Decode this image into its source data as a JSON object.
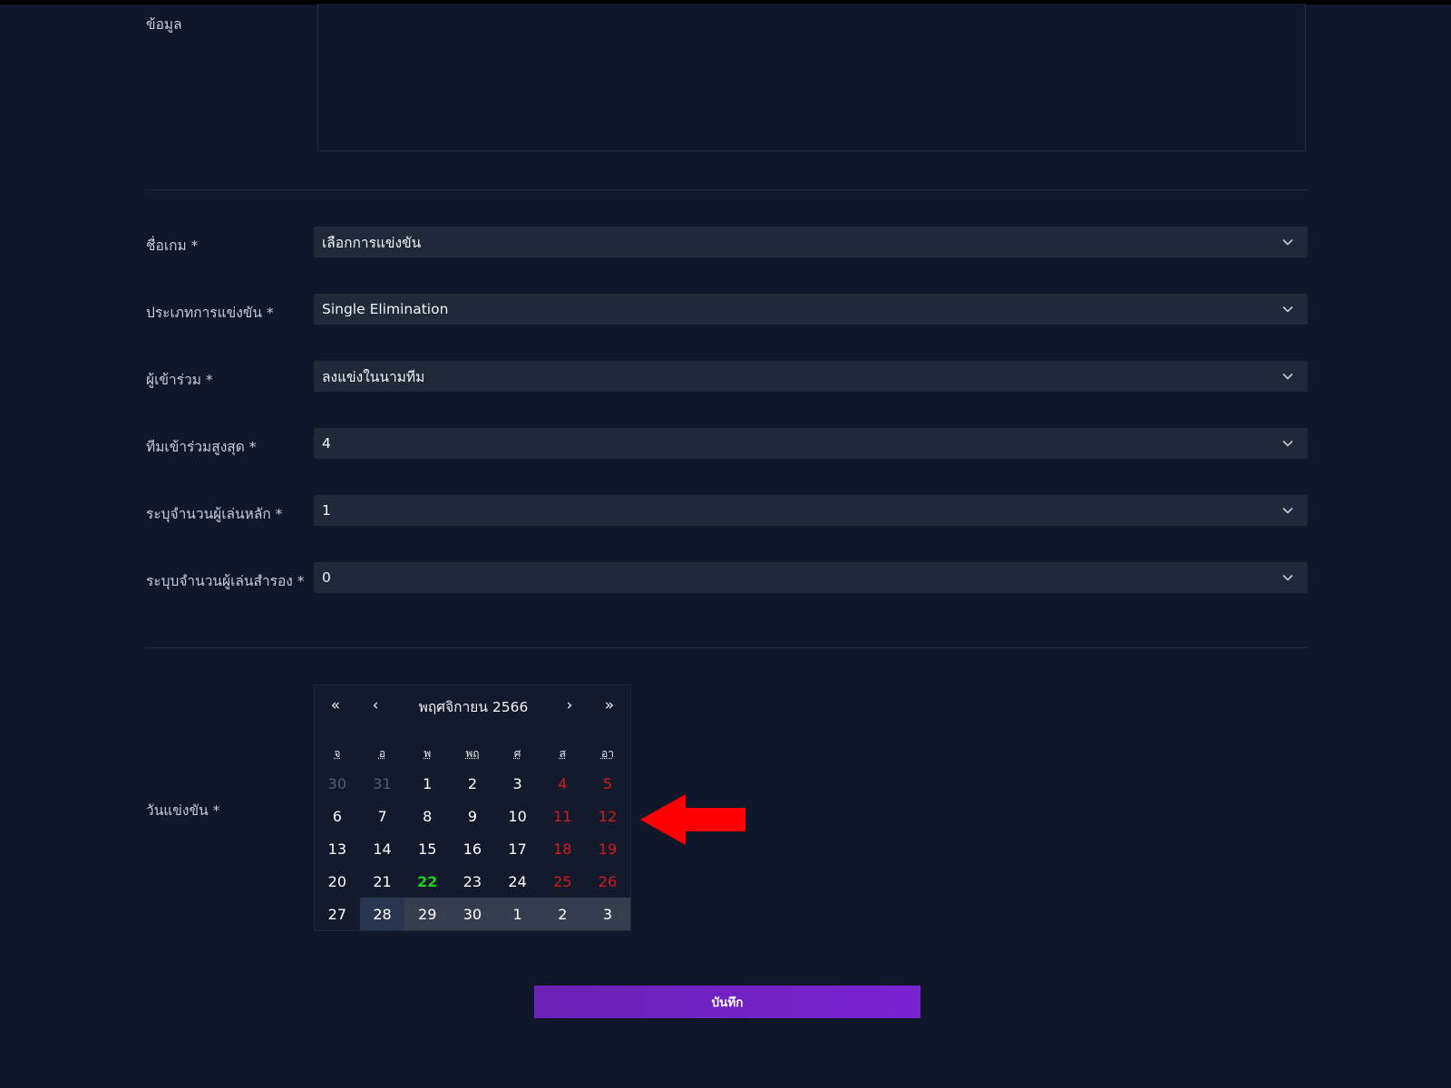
{
  "form": {
    "info_label": "ข้อมูล",
    "game_label": "ชื่อเกม *",
    "game_value": "เลือกการแข่งขัน",
    "type_label": "ประเภทการแข่งขัน *",
    "type_value": "Single Elimination",
    "participant_label": "ผู้เข้าร่วม *",
    "participant_value": "ลงแข่งในนามทีม",
    "max_team_label": "ทีมเข้าร่วมสูงสุด *",
    "max_team_value": "4",
    "main_players_label": "ระบุจำนวนผู้เล่นหลัก *",
    "main_players_value": "1",
    "sub_players_label": "ระบุบจำนวนผู้เล่นสำรอง *",
    "sub_players_value": "0",
    "date_label": "วันแข่งขัน *",
    "save_label": "บันทึก"
  },
  "calendar": {
    "title": "พฤศจิกายน 2566",
    "nav": {
      "prev_year": "«",
      "prev_month": "‹",
      "next_month": "›",
      "next_year": "»"
    },
    "weekdays": [
      "จ",
      "อ",
      "พ",
      "พฤ",
      "ศ",
      "ส",
      "อา"
    ],
    "days": [
      {
        "d": "30",
        "s": "muted"
      },
      {
        "d": "31",
        "s": "muted"
      },
      {
        "d": "1",
        "s": ""
      },
      {
        "d": "2",
        "s": ""
      },
      {
        "d": "3",
        "s": ""
      },
      {
        "d": "4",
        "s": "weekend"
      },
      {
        "d": "5",
        "s": "weekend"
      },
      {
        "d": "6",
        "s": ""
      },
      {
        "d": "7",
        "s": ""
      },
      {
        "d": "8",
        "s": ""
      },
      {
        "d": "9",
        "s": ""
      },
      {
        "d": "10",
        "s": ""
      },
      {
        "d": "11",
        "s": "weekend"
      },
      {
        "d": "12",
        "s": "weekend"
      },
      {
        "d": "13",
        "s": ""
      },
      {
        "d": "14",
        "s": ""
      },
      {
        "d": "15",
        "s": ""
      },
      {
        "d": "16",
        "s": ""
      },
      {
        "d": "17",
        "s": ""
      },
      {
        "d": "18",
        "s": "weekend"
      },
      {
        "d": "19",
        "s": "weekend"
      },
      {
        "d": "20",
        "s": ""
      },
      {
        "d": "21",
        "s": ""
      },
      {
        "d": "22",
        "s": "today"
      },
      {
        "d": "23",
        "s": ""
      },
      {
        "d": "24",
        "s": ""
      },
      {
        "d": "25",
        "s": "weekend"
      },
      {
        "d": "26",
        "s": "weekend"
      },
      {
        "d": "27",
        "s": ""
      },
      {
        "d": "28",
        "s": "hover"
      },
      {
        "d": "29",
        "s": "range"
      },
      {
        "d": "30",
        "s": "range"
      },
      {
        "d": "1",
        "s": "range"
      },
      {
        "d": "2",
        "s": "range"
      },
      {
        "d": "3",
        "s": "range"
      }
    ]
  },
  "colors": {
    "background": "#10172a",
    "select_bg": "#202938",
    "weekend": "#d21b1b",
    "today": "#1bd21b",
    "button": "#7a22d2",
    "arrow": "#ff0000"
  },
  "icons": {
    "select_caret": "chevron-down-icon",
    "annotation": "arrow-left-icon"
  }
}
